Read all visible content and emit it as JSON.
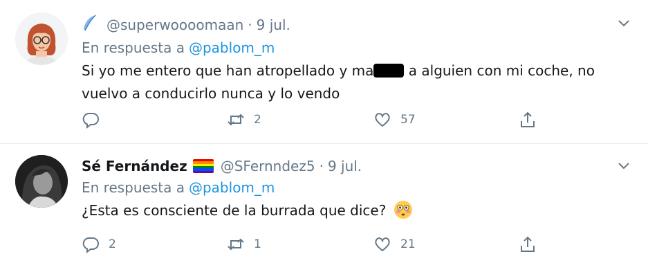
{
  "tweets": [
    {
      "name": "",
      "handle": "@superwoooomaan",
      "dot": "·",
      "date": "9 jul.",
      "reply_prefix": "En respuesta a",
      "reply_to": "@pablom_m",
      "text_before": "Si yo me entero que han atropellado y ma",
      "text_after": " a alguien con mi coche, no vuelvo a conducirlo nunca y lo vendo",
      "replies": "",
      "retweets": "2",
      "likes": "57"
    },
    {
      "name": "Sé Fernández",
      "handle": "@SFernndez5",
      "dot": "·",
      "date": "9 jul.",
      "reply_prefix": "En respuesta a",
      "reply_to": "@pablom_m",
      "text": "¿Esta es consciente de la burrada que dice?",
      "replies": "2",
      "retweets": "1",
      "likes": "21"
    }
  ],
  "colors": {
    "accent": "#1b95e0",
    "muted": "#657786",
    "text": "#14171a",
    "divider": "#e6ecf0"
  },
  "icons": {
    "reply": "reply-icon",
    "retweet": "retweet-icon",
    "like": "heart-icon",
    "share": "share-icon",
    "menu": "chevron-down-icon"
  }
}
